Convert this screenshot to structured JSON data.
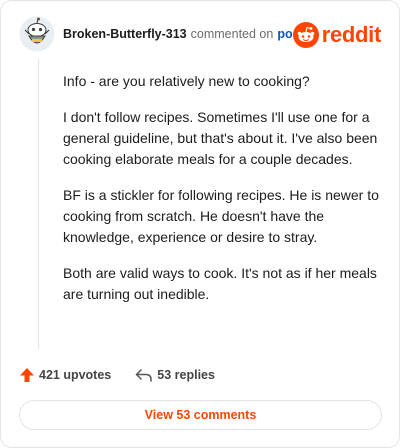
{
  "comment": {
    "author": "Broken-Butterfly-313",
    "action_text": "commented on",
    "post_link": "post",
    "paragraphs": [
      "Info - are you relatively new to cooking?",
      "I don't follow recipes. Sometimes I'll use one for a general guideline, but that's about it. I've also been cooking elaborate meals for a couple decades.",
      "BF is a stickler for following recipes. He is newer to cooking from scratch. He doesn't have the knowledge, experience or desire to stray.",
      "Both are valid ways to cook. It's not as if her meals are turning out inedible."
    ]
  },
  "brand": {
    "name": "reddit",
    "color": "#ff4500"
  },
  "stats": {
    "upvotes": "421 upvotes",
    "replies": "53 replies"
  },
  "view_comments_label": "View 53 comments",
  "icons": {
    "avatar": "snoo-avatar-icon",
    "logo": "reddit-logo-icon",
    "upvote": "upvote-arrow-icon",
    "reply": "reply-arrow-icon"
  }
}
